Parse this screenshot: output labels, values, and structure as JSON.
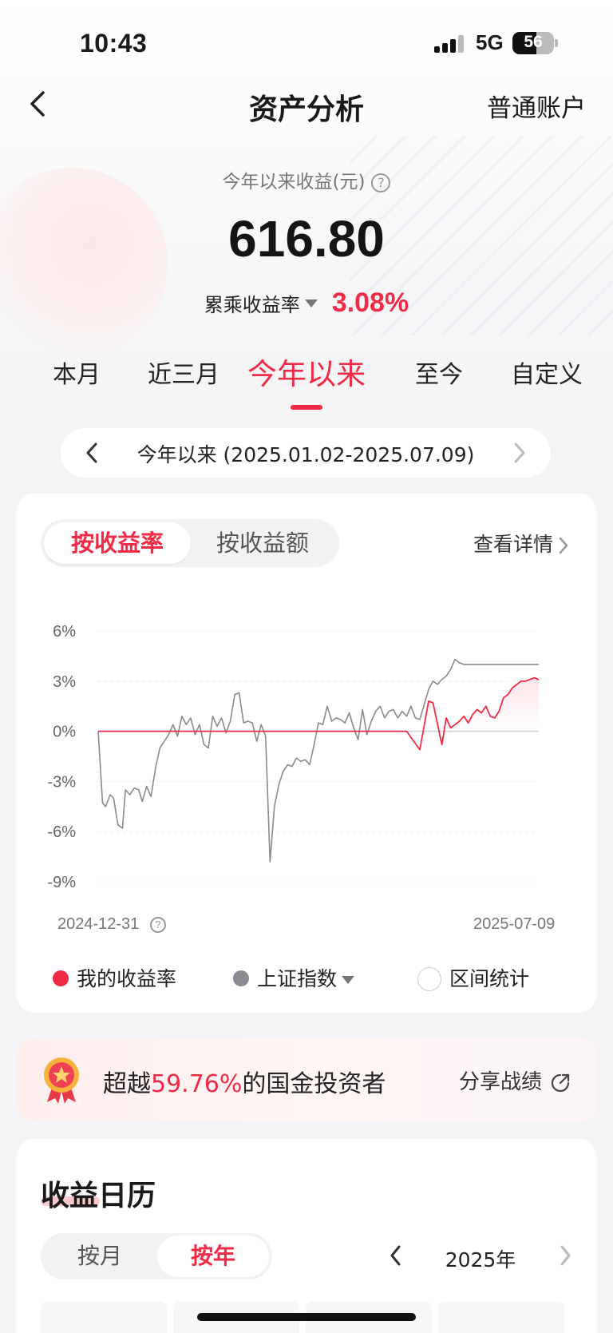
{
  "status_bar": {
    "time": "10:43",
    "network": "5G",
    "battery": "56"
  },
  "nav": {
    "title": "资产分析",
    "right_label": "普通账户"
  },
  "summary": {
    "label": "今年以来收益(元)",
    "value": "616.80",
    "rate_label": "累乘收益率",
    "rate_value": "3.08%"
  },
  "period_tabs": [
    {
      "label": "本月"
    },
    {
      "label": "近三月"
    },
    {
      "label": "今年以来",
      "active": true
    },
    {
      "label": "至今"
    },
    {
      "label": "自定义"
    }
  ],
  "range": {
    "text": "今年以来 (2025.01.02-2025.07.09)"
  },
  "chart_card": {
    "mode_options": [
      "按收益率",
      "按收益额"
    ],
    "active_mode": "按收益率",
    "detail_label": "查看详情",
    "start_date": "2024-12-31",
    "end_date": "2025-07-09",
    "legend": [
      {
        "label": "我的收益率",
        "color": "#f02b45"
      },
      {
        "label": "上证指数",
        "color": "#8a8a90"
      },
      {
        "label": "区间统计",
        "color": "#ffffff"
      }
    ]
  },
  "chart_data": {
    "type": "line",
    "y_ticks": [
      "6%",
      "3%",
      "0%",
      "-3%",
      "-6%",
      "-9%"
    ],
    "ylim": [
      -9,
      6
    ],
    "xlim": [
      0,
      1
    ],
    "grid": true,
    "series": [
      {
        "name": "上证指数",
        "color": "#8a8a90",
        "x": [
          0,
          0.01,
          0.017,
          0.027,
          0.035,
          0.045,
          0.055,
          0.062,
          0.072,
          0.082,
          0.092,
          0.1,
          0.11,
          0.12,
          0.13,
          0.14,
          0.15,
          0.16,
          0.17,
          0.18,
          0.19,
          0.2,
          0.21,
          0.22,
          0.23,
          0.24,
          0.25,
          0.26,
          0.27,
          0.28,
          0.29,
          0.3,
          0.31,
          0.32,
          0.33,
          0.34,
          0.35,
          0.36,
          0.37,
          0.38,
          0.39,
          0.4,
          0.41,
          0.42,
          0.43,
          0.44,
          0.45,
          0.46,
          0.47,
          0.48,
          0.49,
          0.5,
          0.51,
          0.52,
          0.53,
          0.54,
          0.55,
          0.56,
          0.57,
          0.58,
          0.59,
          0.6,
          0.61,
          0.62,
          0.63,
          0.64,
          0.65,
          0.66,
          0.67,
          0.68,
          0.69,
          0.7,
          0.71,
          0.72,
          0.73,
          0.74,
          0.75,
          0.76,
          0.77,
          0.78,
          0.79,
          0.8,
          0.81,
          0.82,
          0.83,
          0.84,
          0.85,
          0.86,
          0.87,
          0.88,
          0.89,
          0.9,
          0.91,
          0.92,
          0.93,
          0.94,
          0.95,
          0.96,
          0.97,
          0.98,
          0.99,
          1.0
        ],
        "values": [
          0,
          -4.3,
          -4.5,
          -3.8,
          -4.0,
          -5.6,
          -5.8,
          -3.5,
          -3.8,
          -3.4,
          -3.5,
          -4.2,
          -3.3,
          -3.9,
          -2.2,
          -1.0,
          -0.6,
          -0.2,
          0.4,
          -0.3,
          0.9,
          0.4,
          0.8,
          -0.2,
          0.4,
          -0.8,
          -1.0,
          0.9,
          0.3,
          0.8,
          -0.1,
          0.6,
          2.2,
          2.3,
          0.5,
          0.6,
          0.5,
          -0.6,
          0.4,
          -0.3,
          -7.8,
          -4.5,
          -3.2,
          -2.4,
          -2.0,
          -2.1,
          -1.6,
          -1.8,
          -1.7,
          -2.0,
          -0.8,
          0.5,
          0.4,
          1.5,
          0.6,
          0.8,
          0.7,
          0.5,
          1.1,
          0.2,
          -0.5,
          1.3,
          -0.2,
          0.6,
          1.2,
          1.5,
          0.8,
          1.2,
          1.3,
          0.8,
          1.2,
          0.9,
          1.5,
          0.8,
          0.7,
          1.6,
          2.5,
          3.0,
          2.8,
          3.1,
          3.3,
          3.7,
          4.3,
          4.1,
          4.0,
          4.0,
          4.0,
          4.0,
          4.0,
          4.0,
          4.0,
          4.0,
          4.0,
          4.0,
          4.0,
          4.0,
          4.0,
          4.0,
          4.0,
          4.0,
          4.0,
          4.0
        ]
      },
      {
        "name": "我的收益率",
        "color": "#f02b45",
        "x": [
          0,
          0.1,
          0.2,
          0.3,
          0.4,
          0.5,
          0.6,
          0.7,
          0.73,
          0.75,
          0.76,
          0.78,
          0.79,
          0.8,
          0.81,
          0.82,
          0.83,
          0.84,
          0.85,
          0.86,
          0.87,
          0.88,
          0.89,
          0.9,
          0.91,
          0.92,
          0.93,
          0.94,
          0.95,
          0.96,
          0.97,
          0.98,
          0.99,
          1.0
        ],
        "values": [
          0,
          0,
          0,
          0,
          0,
          0,
          0,
          0,
          -1.1,
          1.8,
          1.7,
          -0.8,
          0.8,
          0.2,
          0.4,
          0.6,
          0.9,
          0.5,
          1.0,
          1.3,
          1.1,
          1.5,
          0.9,
          0.8,
          1.2,
          2.0,
          2.2,
          2.6,
          2.8,
          3.0,
          3.0,
          3.1,
          3.2,
          3.08
        ]
      }
    ]
  },
  "rank_card": {
    "prefix": "超越",
    "percent": "59.76%",
    "suffix": "的国金投资者",
    "share_label": "分享战绩"
  },
  "calendar": {
    "title_highlight": "收益",
    "title_rest": "日历",
    "mode_options": [
      "按月",
      "按年"
    ],
    "active_mode": "按年",
    "year_label": "2025年"
  }
}
